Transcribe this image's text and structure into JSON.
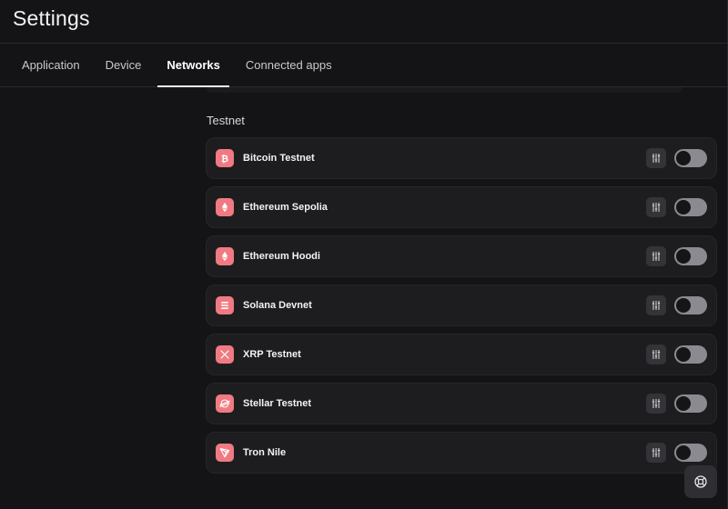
{
  "header": {
    "title": "Settings"
  },
  "tabs": [
    {
      "label": "Application",
      "active": false
    },
    {
      "label": "Device",
      "active": false
    },
    {
      "label": "Networks",
      "active": true
    },
    {
      "label": "Connected apps",
      "active": false
    }
  ],
  "testnet": {
    "title": "Testnet",
    "networks": [
      {
        "label": "Bitcoin Testnet",
        "icon": "bitcoin-icon",
        "enabled": false
      },
      {
        "label": "Ethereum Sepolia",
        "icon": "ethereum-icon",
        "enabled": false
      },
      {
        "label": "Ethereum Hoodi",
        "icon": "ethereum-icon",
        "enabled": false
      },
      {
        "label": "Solana Devnet",
        "icon": "solana-icon",
        "enabled": false
      },
      {
        "label": "XRP Testnet",
        "icon": "xrp-icon",
        "enabled": false
      },
      {
        "label": "Stellar Testnet",
        "icon": "stellar-icon",
        "enabled": false
      },
      {
        "label": "Tron Nile",
        "icon": "tron-icon",
        "enabled": false
      }
    ]
  },
  "colors": {
    "accent": "#f07a82",
    "background": "#141416",
    "row": "#1d1d20",
    "toggle_off": "#8a8a90"
  }
}
